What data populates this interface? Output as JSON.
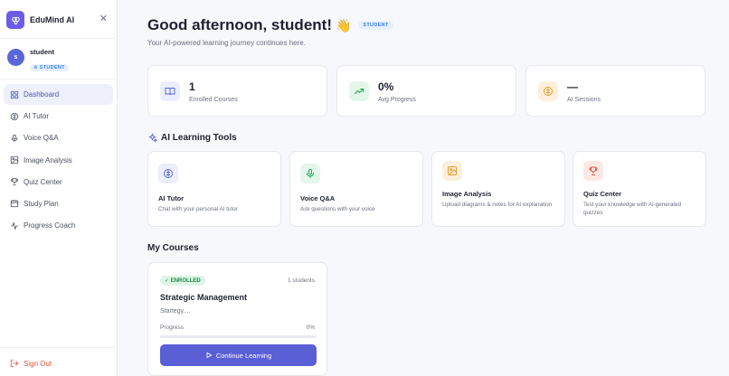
{
  "brand": {
    "name": "EduMind AI"
  },
  "user": {
    "name": "student",
    "initial": "s",
    "role": "STUDENT"
  },
  "sidebar": {
    "items": [
      {
        "label": "Dashboard",
        "icon": "grid-icon",
        "active": true
      },
      {
        "label": "AI Tutor",
        "icon": "brain-icon"
      },
      {
        "label": "Voice Q&A",
        "icon": "mic-icon"
      },
      {
        "label": "Image Analysis",
        "icon": "image-icon"
      },
      {
        "label": "Quiz Center",
        "icon": "trophy-icon"
      },
      {
        "label": "Study Plan",
        "icon": "calendar-icon"
      },
      {
        "label": "Progress Coach",
        "icon": "activity-icon"
      }
    ],
    "sign_out": "Sign Out"
  },
  "header": {
    "greeting": "Good afternoon, student!",
    "wave": "👋",
    "role_badge": "STUDENT",
    "subtitle": "Your AI-powered learning journey continues here."
  },
  "stats": [
    {
      "value": "1",
      "label": "Enrolled Courses",
      "icon": "book-icon",
      "color": "#5a67d8"
    },
    {
      "value": "0%",
      "label": "Avg Progress",
      "icon": "trending-up-icon",
      "color": "#22a55b"
    },
    {
      "value": "—",
      "label": "AI Sessions",
      "icon": "brain-icon",
      "color": "#e39b2b"
    }
  ],
  "tools": {
    "title": "AI Learning Tools",
    "items": [
      {
        "title": "AI Tutor",
        "desc": "Chat with your personal AI tutor",
        "icon": "brain-icon"
      },
      {
        "title": "Voice Q&A",
        "desc": "Ask questions with your voice",
        "icon": "mic-icon"
      },
      {
        "title": "Image Analysis",
        "desc": "Upload diagrams & notes for AI explanation",
        "icon": "image-icon"
      },
      {
        "title": "Quiz Center",
        "desc": "Test your knowledge with AI-generated quizzes",
        "icon": "trophy-icon"
      }
    ]
  },
  "courses": {
    "title": "My Courses",
    "items": [
      {
        "status": "✓ ENROLLED",
        "students": "1 students",
        "title": "Strategic Management",
        "desc": "Startegy....",
        "progress_label": "Progress",
        "progress_text": "0%",
        "progress": 0,
        "button": "Continue Learning"
      }
    ]
  },
  "colors": {
    "accent": "#5b5fd6",
    "brand": "#6c5ce7",
    "danger": "#e0533d"
  }
}
